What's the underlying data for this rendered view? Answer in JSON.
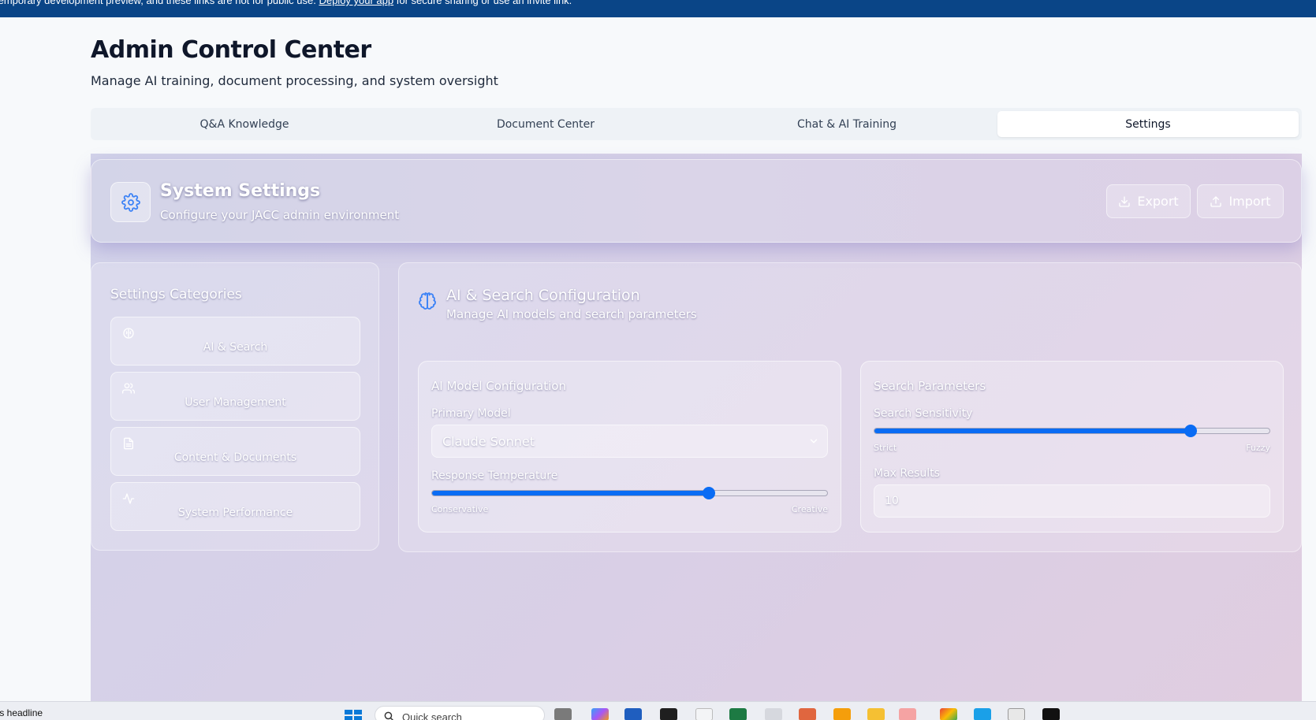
{
  "banner": {
    "text_before": "temporary development preview, and these links are not for public use. ",
    "link": "Deploy your app",
    "text_after": " for secure sharing or use an invite link."
  },
  "page": {
    "title": "Admin Control Center",
    "subtitle": "Manage AI training, document processing, and system oversight"
  },
  "tabs": [
    {
      "label": "Q&A Knowledge",
      "active": false
    },
    {
      "label": "Document Center",
      "active": false
    },
    {
      "label": "Chat & AI Training",
      "active": false
    },
    {
      "label": "Settings",
      "active": true
    }
  ],
  "settings_header": {
    "icon": "gear-icon",
    "title": "System Settings",
    "subtitle": "Configure your JACC admin environment",
    "export_label": "Export",
    "import_label": "Import"
  },
  "categories": {
    "title": "Settings Categories",
    "items": [
      {
        "icon": "brain-icon",
        "label": "AI & Search"
      },
      {
        "icon": "users-icon",
        "label": "User Management"
      },
      {
        "icon": "file-icon",
        "label": "Content & Documents"
      },
      {
        "icon": "activity-icon",
        "label": "System Performance"
      }
    ]
  },
  "ai_config": {
    "icon": "brain-icon",
    "title": "AI & Search Configuration",
    "subtitle": "Manage AI models and search parameters",
    "model_card": {
      "title": "AI Model Configuration",
      "primary_model_label": "Primary Model",
      "primary_model_value": "Claude Sonnet",
      "temperature_label": "Response Temperature",
      "temperature_value": 0.7,
      "temperature_min_label": "Conservative",
      "temperature_max_label": "Creative"
    },
    "search_card": {
      "title": "Search Parameters",
      "sensitivity_label": "Search Sensitivity",
      "sensitivity_value": 0.8,
      "sensitivity_min_label": "Strict",
      "sensitivity_max_label": "Fuzzy",
      "max_results_label": "Max Results",
      "max_results_value": "10"
    }
  },
  "taskbar": {
    "news_text": "rts headline",
    "search_placeholder": "Quick search"
  },
  "colors": {
    "banner": "#0a4587",
    "accent": "#0a6cf4",
    "gradient_start": "#d2d3ea",
    "gradient_end": "#e0cde0"
  }
}
